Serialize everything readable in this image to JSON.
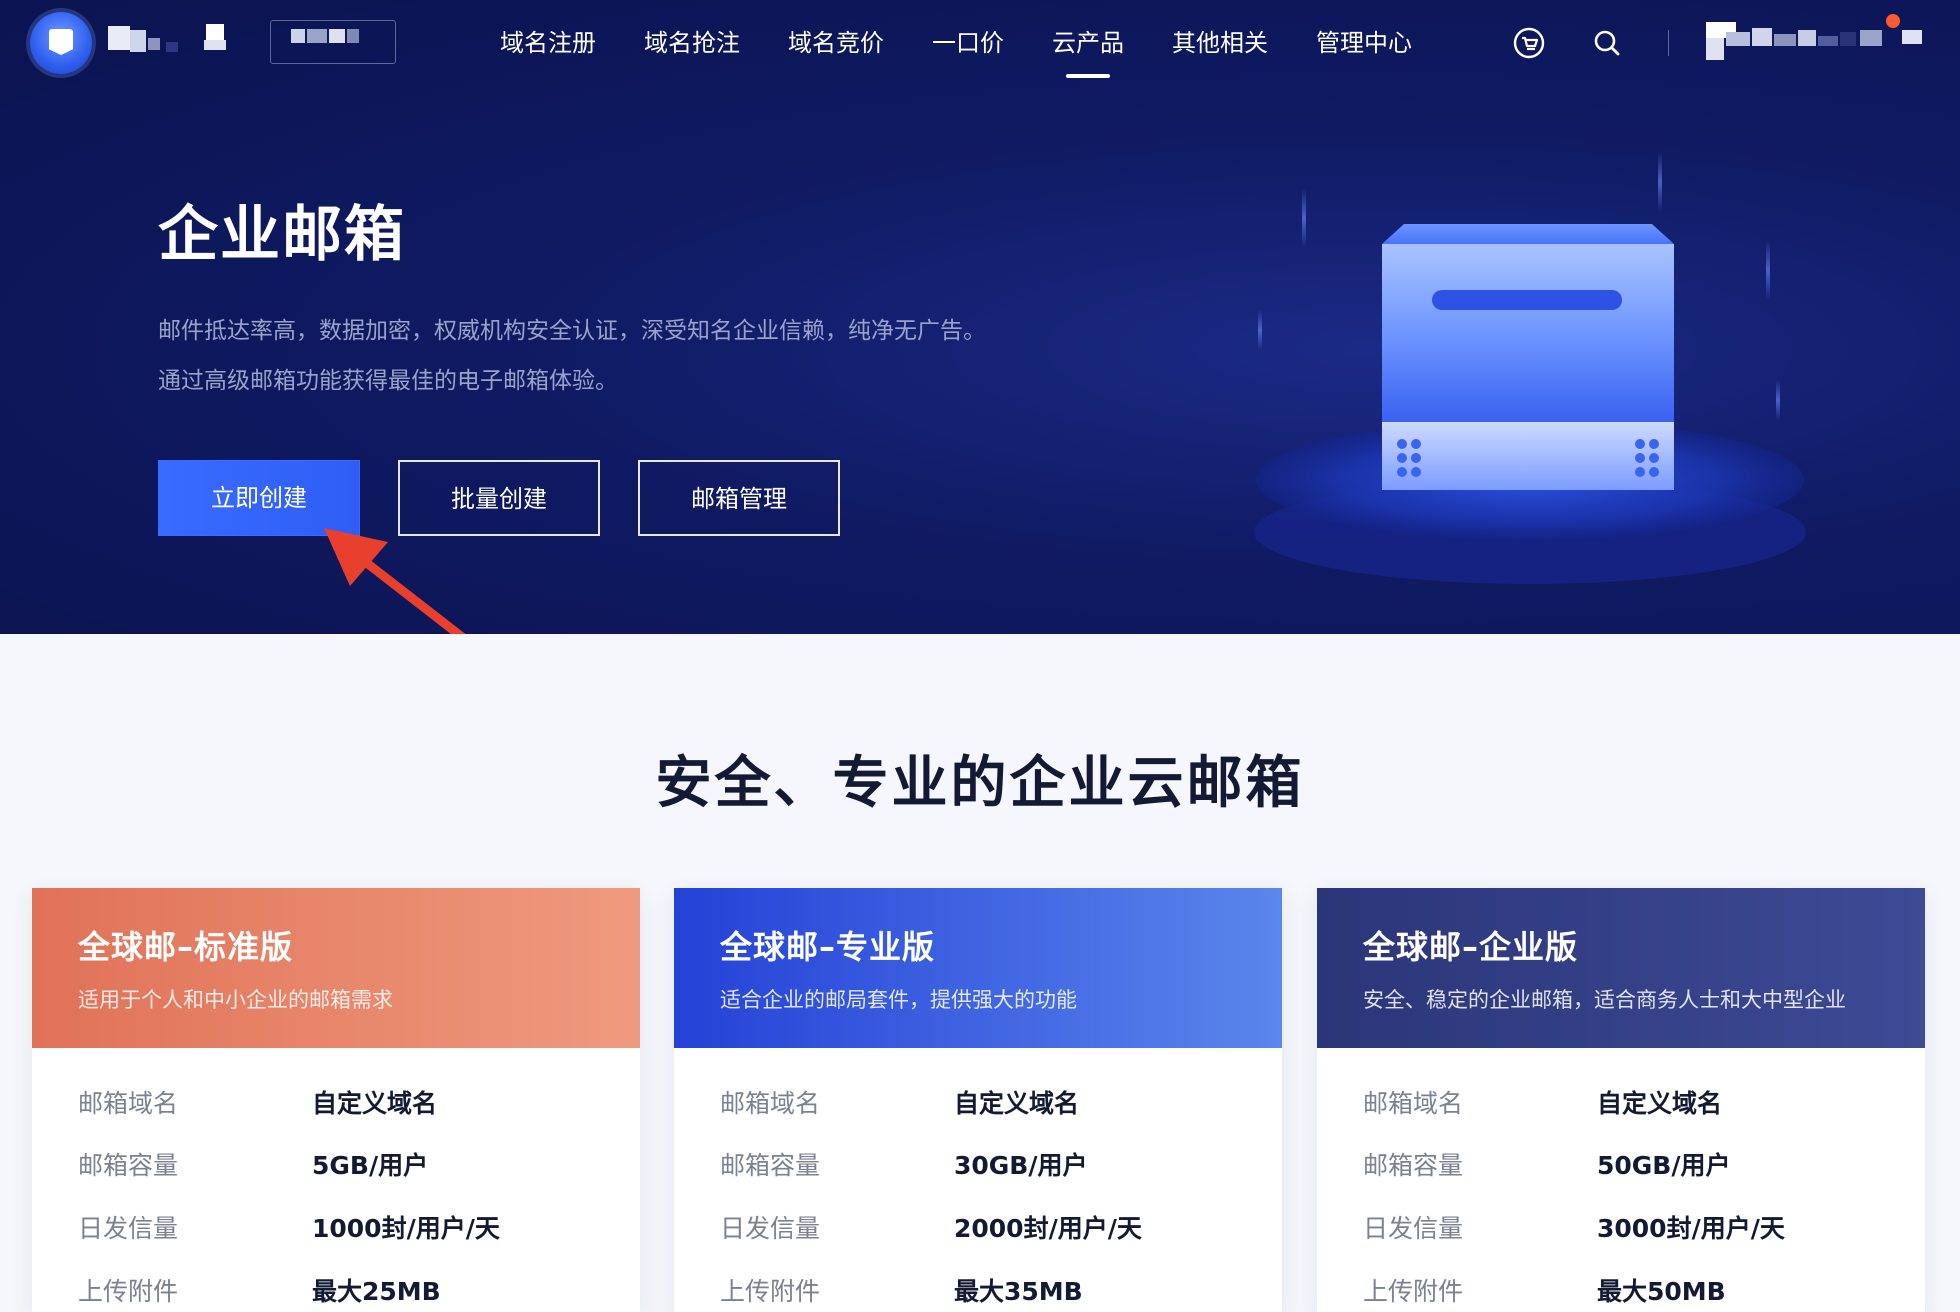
{
  "nav": {
    "items": [
      "域名注册",
      "域名抢注",
      "域名竞价",
      "一口价",
      "云产品",
      "其他相关",
      "管理中心"
    ],
    "active_index": 4,
    "icons": [
      "cart-icon",
      "search-icon"
    ]
  },
  "hero": {
    "title": "企业邮箱",
    "desc_line1": "邮件抵达率高，数据加密，权威机构安全认证，深受知名企业信赖，纯净无广告。",
    "desc_line2": "通过高级邮箱功能获得最佳的电子邮箱体验。",
    "buttons": {
      "create": "立即创建",
      "batch": "批量创建",
      "manage": "邮箱管理"
    }
  },
  "section": {
    "title": "安全、专业的企业云邮箱"
  },
  "plans": [
    {
      "name": "全球邮–标准版",
      "desc": "适用于个人和中小企业的邮箱需求",
      "specs": [
        {
          "label": "邮箱域名",
          "value": "自定义域名"
        },
        {
          "label": "邮箱容量",
          "value": "5GB/用户"
        },
        {
          "label": "日发信量",
          "value": "1000封/用户/天"
        },
        {
          "label": "上传附件",
          "value": "最大25MB"
        }
      ]
    },
    {
      "name": "全球邮–专业版",
      "desc": "适合企业的邮局套件，提供强大的功能",
      "specs": [
        {
          "label": "邮箱域名",
          "value": "自定义域名"
        },
        {
          "label": "邮箱容量",
          "value": "30GB/用户"
        },
        {
          "label": "日发信量",
          "value": "2000封/用户/天"
        },
        {
          "label": "上传附件",
          "value": "最大35MB"
        }
      ]
    },
    {
      "name": "全球邮–企业版",
      "desc": "安全、稳定的企业邮箱，适合商务人士和大中型企业",
      "specs": [
        {
          "label": "邮箱域名",
          "value": "自定义域名"
        },
        {
          "label": "邮箱容量",
          "value": "50GB/用户"
        },
        {
          "label": "日发信量",
          "value": "3000封/用户/天"
        },
        {
          "label": "上传附件",
          "value": "最大50MB"
        }
      ]
    }
  ],
  "colors": {
    "hero_bg": "#0f1a62",
    "primary": "#3a6bff",
    "annotation_arrow": "#e8402c",
    "plan_standard": "#e07258",
    "plan_pro": "#2442d6",
    "plan_enterprise": "#2b3679"
  }
}
